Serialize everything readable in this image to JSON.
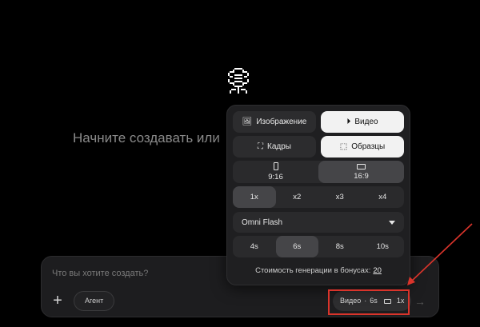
{
  "headline": "Начните создавать или",
  "composer": {
    "placeholder": "Что вы хотите создать?",
    "plus_icon": "plus-icon",
    "agent_label": "Агент",
    "settings_mode": "Видео",
    "settings_duration": "6s",
    "settings_multiplier": "1x",
    "send_icon": "arrow-right-icon"
  },
  "panel": {
    "mode_tabs": [
      {
        "label": "Изображение",
        "icon": "image-icon",
        "active": false
      },
      {
        "label": "Видео",
        "icon": "play-circle-icon",
        "active": true
      }
    ],
    "input_tabs": [
      {
        "label": "Кадры",
        "icon": "crop-icon",
        "active": false
      },
      {
        "label": "Образцы",
        "icon": "sticker-icon",
        "active": true
      }
    ],
    "aspect_ratios": [
      {
        "label": "9:16",
        "active": false
      },
      {
        "label": "16:9",
        "active": true
      }
    ],
    "counts": [
      {
        "label": "1x",
        "active": true
      },
      {
        "label": "x2",
        "active": false
      },
      {
        "label": "x3",
        "active": false
      },
      {
        "label": "x4",
        "active": false
      }
    ],
    "model": "Omni Flash",
    "durations": [
      {
        "label": "4s",
        "active": false
      },
      {
        "label": "6s",
        "active": true
      },
      {
        "label": "8s",
        "active": false
      },
      {
        "label": "10s",
        "active": false
      }
    ],
    "cost_label": "Стоимость генерации в бонусах:",
    "cost_value": "20"
  },
  "colors": {
    "background": "#000000",
    "panel": "#1f1f21",
    "active_button": "#f2f2f2",
    "highlight": "#d9342b"
  }
}
